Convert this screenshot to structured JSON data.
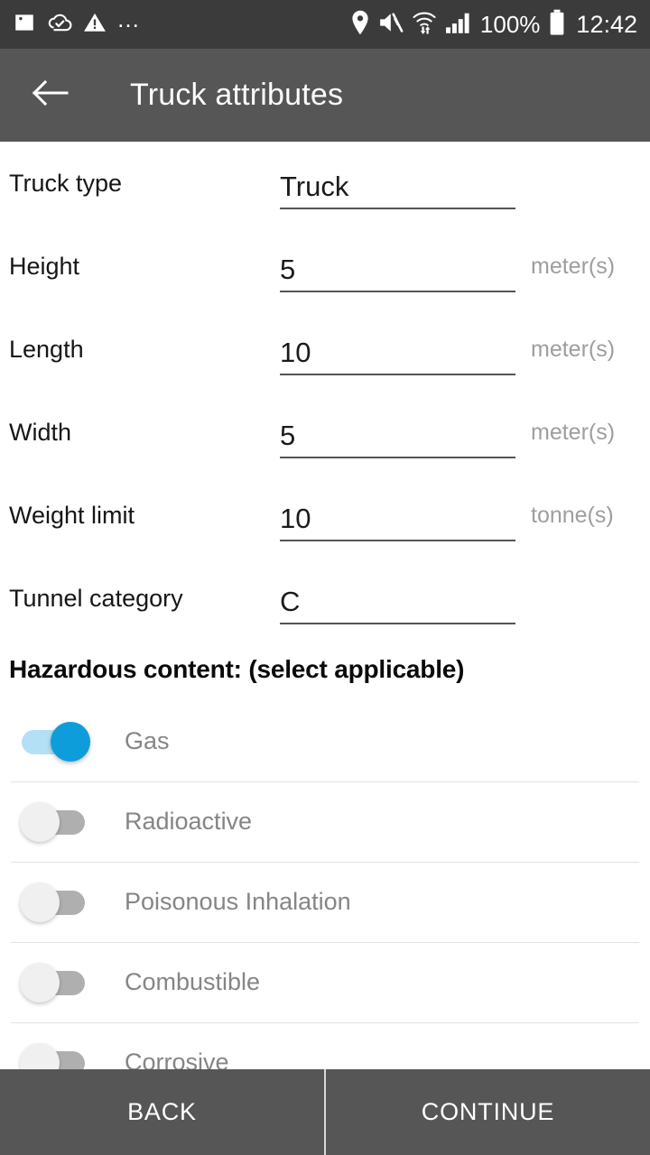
{
  "status_bar": {
    "left_icons": [
      "image-icon",
      "cloud-done-icon",
      "warning-triangle-icon",
      "more-dots-icon"
    ],
    "right_icons": [
      "location-pin-icon",
      "volume-muted-icon",
      "wifi-transfer-icon",
      "cellular-signal-icon"
    ],
    "battery_percent": "100%",
    "battery_icon": "battery-full-icon",
    "clock": "12:42",
    "background_color": "#3b3b3b"
  },
  "app_bar": {
    "back_icon": "back-arrow-icon",
    "title": "Truck attributes",
    "background_color": "#565656"
  },
  "form": {
    "fields": [
      {
        "label": "Truck type",
        "value": "Truck",
        "unit": ""
      },
      {
        "label": "Height",
        "value": "5",
        "unit": "meter(s)"
      },
      {
        "label": "Length",
        "value": "10",
        "unit": "meter(s)"
      },
      {
        "label": "Width",
        "value": "5",
        "unit": "meter(s)"
      },
      {
        "label": "Weight limit",
        "value": "10",
        "unit": "tonne(s)"
      },
      {
        "label": "Tunnel category",
        "value": "C",
        "unit": ""
      }
    ]
  },
  "hazardous": {
    "heading": "Hazardous content: (select applicable)",
    "items": [
      {
        "label": "Gas",
        "on": true
      },
      {
        "label": "Radioactive",
        "on": false
      },
      {
        "label": "Poisonous Inhalation",
        "on": false
      },
      {
        "label": "Combustible",
        "on": false
      },
      {
        "label": "Corrosive",
        "on": false
      }
    ],
    "toggle_on_track_color": "#b3e0f5",
    "toggle_on_thumb_color": "#0d9ddb",
    "toggle_off_track_color": "#afafaf",
    "toggle_off_thumb_color": "#f0f0f0"
  },
  "bottom_bar": {
    "back_label": "BACK",
    "continue_label": "CONTINUE"
  }
}
